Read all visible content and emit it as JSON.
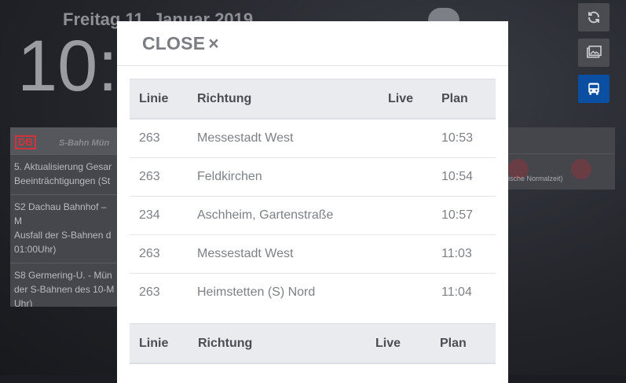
{
  "background": {
    "date": "Freitag 11. Januar 2019",
    "time": "10:",
    "news": {
      "logo": "DB",
      "brand": "S-Bahn Mün",
      "items": [
        "5. Aktualisierung Gesar\nBeeinträchtigungen (St",
        "S2 Dachau Bahnhof – M\nAusfall der S-Bahnen d\n01:00Uhr)",
        "S8 Germering-U. - Mün\nder S-Bahnen des 10-M\nUhr)"
      ]
    },
    "right_note": "ische Normalzeit)"
  },
  "side_buttons": {
    "refresh_icon": "refresh-icon",
    "gallery_icon": "image-gallery-icon",
    "bus_icon": "bus-icon"
  },
  "modal": {
    "close_label": "CLOSE",
    "close_symbol": "×",
    "columns": [
      "Linie",
      "Richtung",
      "Live",
      "Plan"
    ],
    "rows": [
      {
        "line": "263",
        "direction": "Messestadt West",
        "live": "",
        "plan": "10:53"
      },
      {
        "line": "263",
        "direction": "Feldkirchen",
        "live": "",
        "plan": "10:54"
      },
      {
        "line": "234",
        "direction": "Aschheim, Gartenstraße",
        "live": "",
        "plan": "10:57"
      },
      {
        "line": "263",
        "direction": "Messestadt West",
        "live": "",
        "plan": "11:03"
      },
      {
        "line": "263",
        "direction": "Heimstetten (S) Nord",
        "live": "",
        "plan": "11:04"
      }
    ],
    "columns2": [
      "Linie",
      "Richtung",
      "Live",
      "Plan"
    ]
  },
  "colors": {
    "accent": "#0b4fa2",
    "db_red": "#d2333a"
  }
}
